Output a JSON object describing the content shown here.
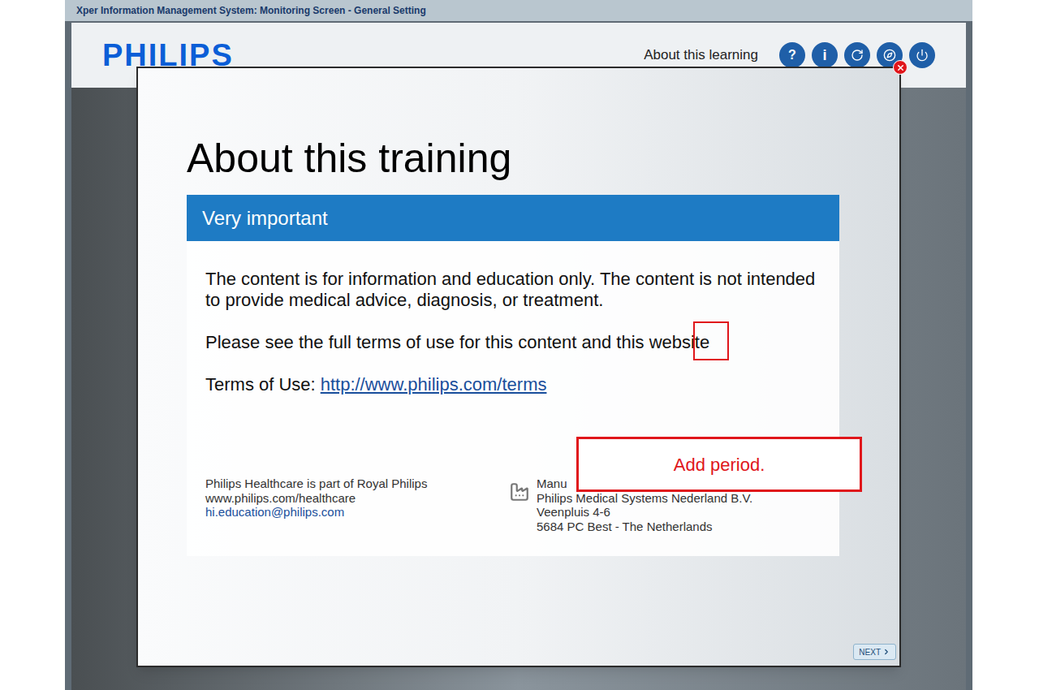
{
  "window": {
    "title": "Xper Information Management System: Monitoring Screen - General Setting"
  },
  "header": {
    "logo": "PHILIPS",
    "link": "About this learning",
    "help_glyph": "?",
    "info_glyph": "i"
  },
  "dialog": {
    "heading": "About this training",
    "banner": "Very important",
    "paragraphs": [
      "The content is for information and education only. The content is not intended to provide medical advice, diagnosis, or treatment."
    ],
    "marked_paragraph": "Please see the full terms of use for this content and this website",
    "terms": {
      "label": "Terms of Use:",
      "link": "http://www.philips.com/terms"
    },
    "footer": {
      "left": [
        "Philips Healthcare is part of Royal Philips",
        "www.philips.com/healthcare"
      ],
      "email": "hi.education@philips.com",
      "right": [
        "Manu",
        "Philips Medical Systems Nederland B.V.",
        "Veenpluis 4-6",
        "5684 PC Best - The Netherlands"
      ]
    },
    "next": "NEXT",
    "annotation": "Add period."
  }
}
